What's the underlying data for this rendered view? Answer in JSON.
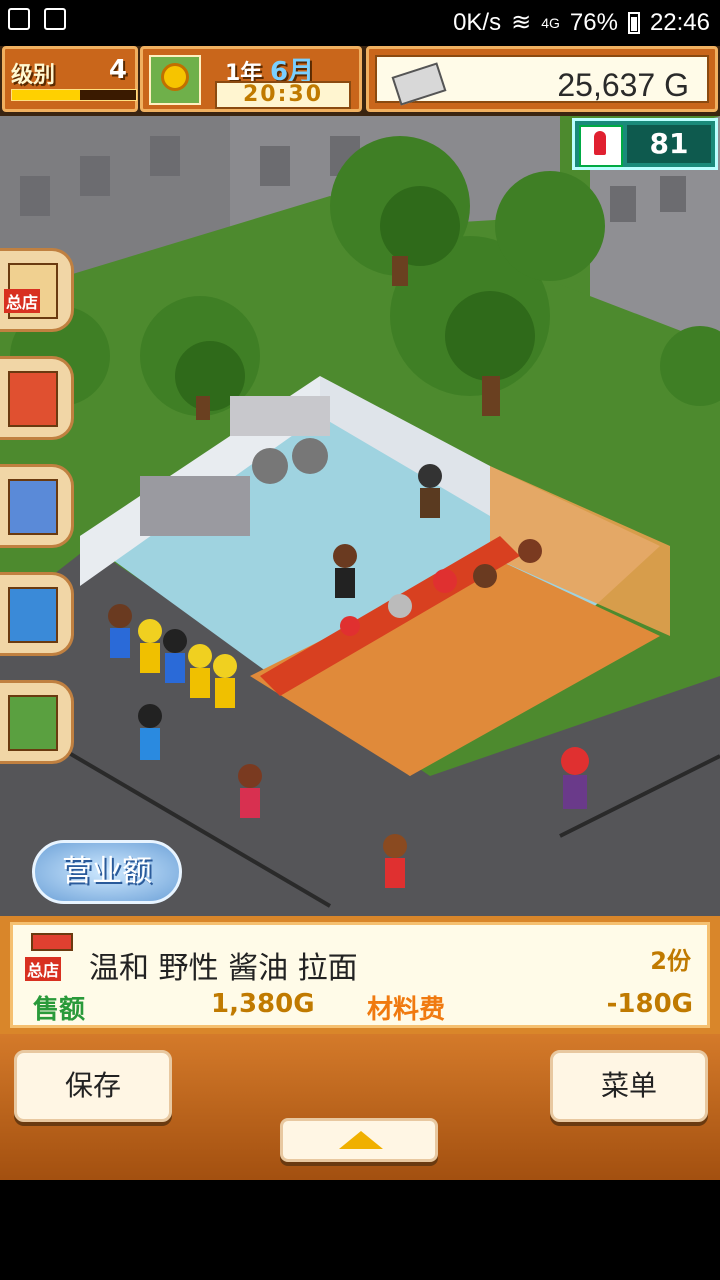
{
  "status_bar": {
    "speed": "0K/s",
    "network": "4G",
    "battery": "76%",
    "time": "22:46"
  },
  "hud": {
    "level_label": "级别",
    "level": "4",
    "level_progress": 0.55,
    "year_label": "1年",
    "month_label": "6月",
    "time": "20:30",
    "money": "25,637",
    "money_unit": "G",
    "popularity": "81"
  },
  "side_buttons": [
    {
      "name": "shop",
      "tag": "总店"
    },
    {
      "name": "staff"
    },
    {
      "name": "menu-board"
    },
    {
      "name": "ingredients"
    },
    {
      "name": "items"
    }
  ],
  "scene": {
    "sales_badge": "营业额"
  },
  "info_panel": {
    "shop_tag": "总店",
    "dish": "温和 野性 酱油 拉面",
    "count": "2份",
    "sales_label": "售额",
    "sales_value": "1,380G",
    "cost_label": "材料费",
    "cost_value": "-180G"
  },
  "buttons": {
    "save": "保存",
    "menu": "菜单"
  }
}
